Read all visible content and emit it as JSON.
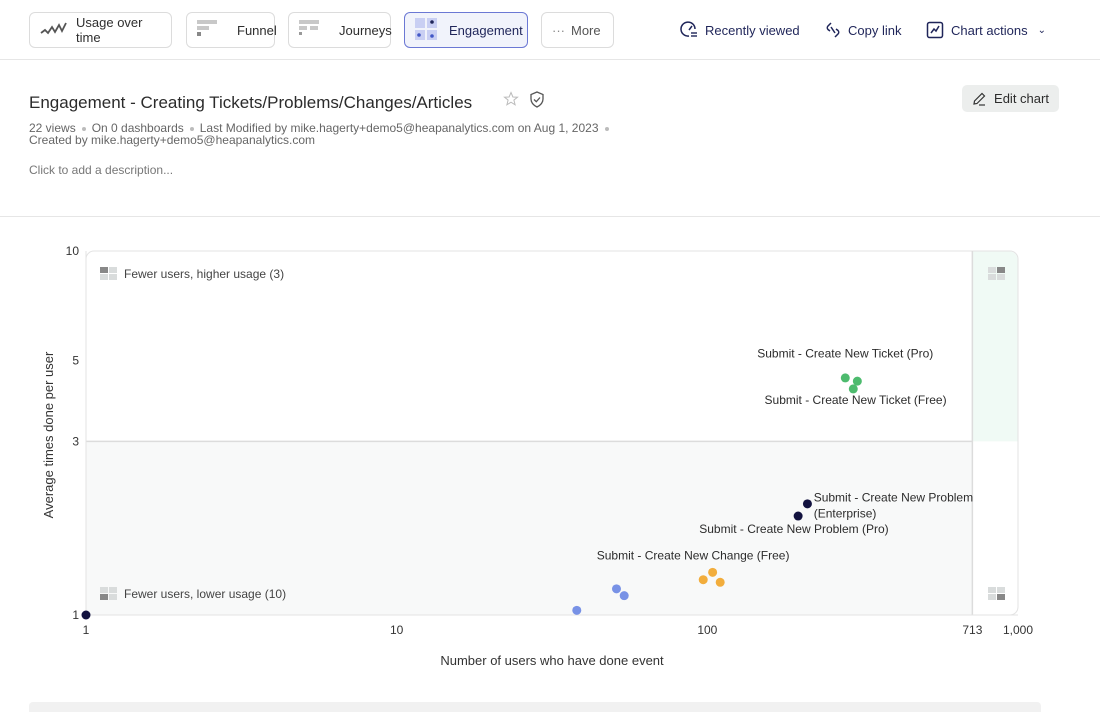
{
  "tabs": [
    {
      "label": "Usage over time",
      "icon": "usage-line-icon",
      "active": false
    },
    {
      "label": "Funnel",
      "icon": "funnel-icon",
      "active": false
    },
    {
      "label": "Journeys",
      "icon": "journeys-icon",
      "active": false
    },
    {
      "label": "Engagement",
      "icon": "engagement-icon",
      "active": true
    },
    {
      "label": "More",
      "icon": "ellipsis-icon",
      "active": false
    }
  ],
  "toolbar": {
    "recently_viewed": "Recently viewed",
    "copy_link": "Copy link",
    "chart_actions": "Chart actions"
  },
  "header": {
    "title": "Engagement - Creating Tickets/Problems/Changes/Articles",
    "views": "22 views",
    "dashboards": "On 0 dashboards",
    "last_modified": "Last Modified by mike.hagerty+demo5@heapanalytics.com on Aug 1, 2023",
    "created_by": "Created by mike.hagerty+demo5@heapanalytics.com",
    "description_placeholder": "Click to add a description...",
    "edit_label": "Edit chart"
  },
  "colors": {
    "accent": "#1f2559",
    "active_tab_border": "#6b78d4",
    "green": "#4dbb6e",
    "navy": "#12123f",
    "orange": "#f2ad3c",
    "blue": "#7892e6",
    "quadrant_green": "#f0faf5",
    "quadrant_gray": "#f8f9f9"
  },
  "chart_data": {
    "type": "scatter",
    "xlabel": "Number of users who have done event",
    "ylabel": "Average times done per user",
    "xscale": "log",
    "yscale": "log",
    "xlim": [
      1,
      1000
    ],
    "ylim": [
      1,
      10
    ],
    "xticks": [
      {
        "v": 1,
        "label": "1"
      },
      {
        "v": 10,
        "label": "10"
      },
      {
        "v": 100,
        "label": "100"
      },
      {
        "v": 713,
        "label": "713"
      },
      {
        "v": 1000,
        "label": "1,000"
      }
    ],
    "yticks": [
      {
        "v": 1,
        "label": "1"
      },
      {
        "v": 3,
        "label": "3"
      },
      {
        "v": 5,
        "label": "5"
      },
      {
        "v": 10,
        "label": "10"
      }
    ],
    "x_divider": 713,
    "y_divider": 3,
    "quadrants": [
      {
        "name": "top-left",
        "label": "Fewer users, higher usage",
        "count": "(3)"
      },
      {
        "name": "bottom-left",
        "label": "Fewer users, lower usage",
        "count": "(10)"
      },
      {
        "name": "top-right",
        "label": "",
        "count": ""
      },
      {
        "name": "bottom-right",
        "label": "",
        "count": ""
      }
    ],
    "series": [
      {
        "name": "green",
        "color": "#4dbb6e",
        "points": [
          {
            "x": 278,
            "y": 4.48
          },
          {
            "x": 304,
            "y": 4.39
          },
          {
            "x": 295,
            "y": 4.18
          }
        ]
      },
      {
        "name": "navy",
        "color": "#12123f",
        "points": [
          {
            "x": 210,
            "y": 2.02
          },
          {
            "x": 196,
            "y": 1.87
          },
          {
            "x": 1,
            "y": 1.0
          }
        ]
      },
      {
        "name": "orange",
        "color": "#f2ad3c",
        "points": [
          {
            "x": 104,
            "y": 1.31
          },
          {
            "x": 97,
            "y": 1.25
          },
          {
            "x": 110,
            "y": 1.23
          }
        ]
      },
      {
        "name": "blue",
        "color": "#7892e6",
        "points": [
          {
            "x": 51,
            "y": 1.18
          },
          {
            "x": 54,
            "y": 1.13
          },
          {
            "x": 38,
            "y": 1.03
          }
        ]
      }
    ],
    "annotations": [
      {
        "text": "Submit - Create New Ticket (Pro)",
        "x": 278,
        "y": 5.1,
        "anchor": "middle"
      },
      {
        "text": "Submit - Create New Ticket (Free)",
        "x": 300,
        "y": 3.8,
        "anchor": "middle"
      },
      {
        "text": "Submit - Create New Problem",
        "x": 220,
        "y": 2.05,
        "anchor": "start"
      },
      {
        "text": "(Enterprise)",
        "x": 220,
        "y": 1.85,
        "anchor": "start"
      },
      {
        "text": "Submit - Create New Problem (Pro)",
        "x": 190,
        "y": 1.68,
        "anchor": "middle"
      },
      {
        "text": "Submit - Create New Change (Free)",
        "x": 90,
        "y": 1.42,
        "anchor": "middle"
      }
    ]
  }
}
